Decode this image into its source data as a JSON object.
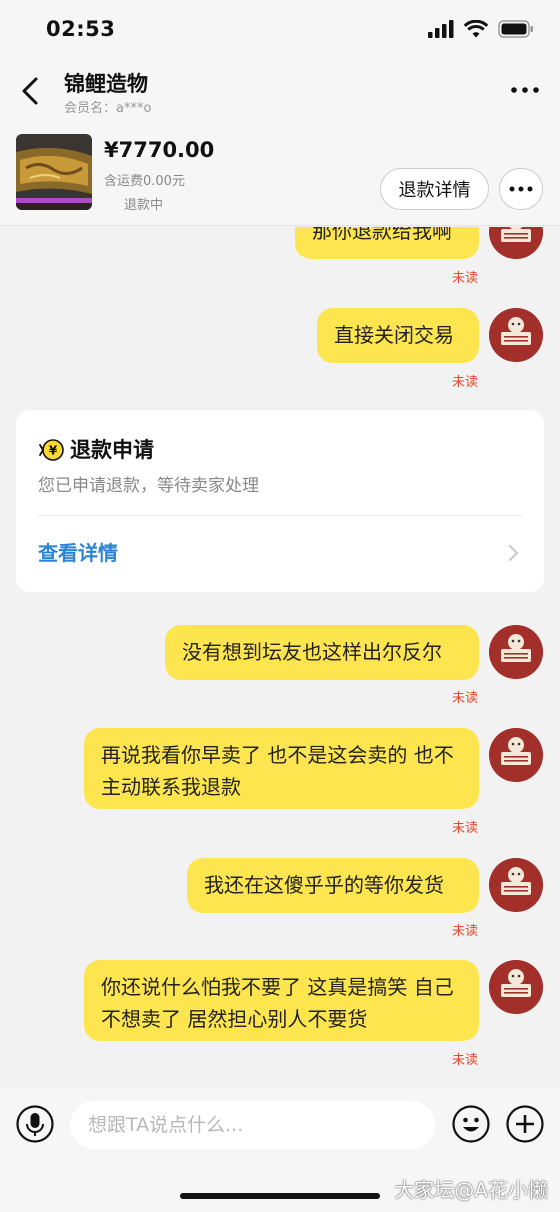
{
  "status_bar": {
    "time": "02:53"
  },
  "header": {
    "shop_name": "锦鲤造物",
    "member": "会员名：a***o"
  },
  "product": {
    "price": "¥7770.00",
    "shipping": "含运费0.00元",
    "status": "退款中",
    "refund_details_label": "退款详情"
  },
  "messages": [
    {
      "text": "那你退款给我啊",
      "status": "未读"
    },
    {
      "text": "直接关闭交易",
      "status": "未读"
    },
    {
      "text": "没有想到坛友也这样出尔反尔",
      "status": "未读"
    },
    {
      "text": "再说我看你早卖了 也不是这会卖的 也不主动联系我退款",
      "status": "未读"
    },
    {
      "text": "我还在这傻乎乎的等你发货",
      "status": "未读"
    },
    {
      "text": "你还说什么怕我不要了 这真是搞笑 自己不想卖了 居然担心别人不要货",
      "status": "未读"
    }
  ],
  "refund_card": {
    "title": "退款申请",
    "desc": "您已申请退款，等待卖家处理",
    "link": "查看详情"
  },
  "input": {
    "placeholder": "想跟TA说点什么..."
  },
  "watermark": "大家坛@A花小懒",
  "colors": {
    "bubble": "#fde54f",
    "unread": "#e8482c",
    "link": "#2e84d4",
    "avatar": "#a32f2b"
  }
}
